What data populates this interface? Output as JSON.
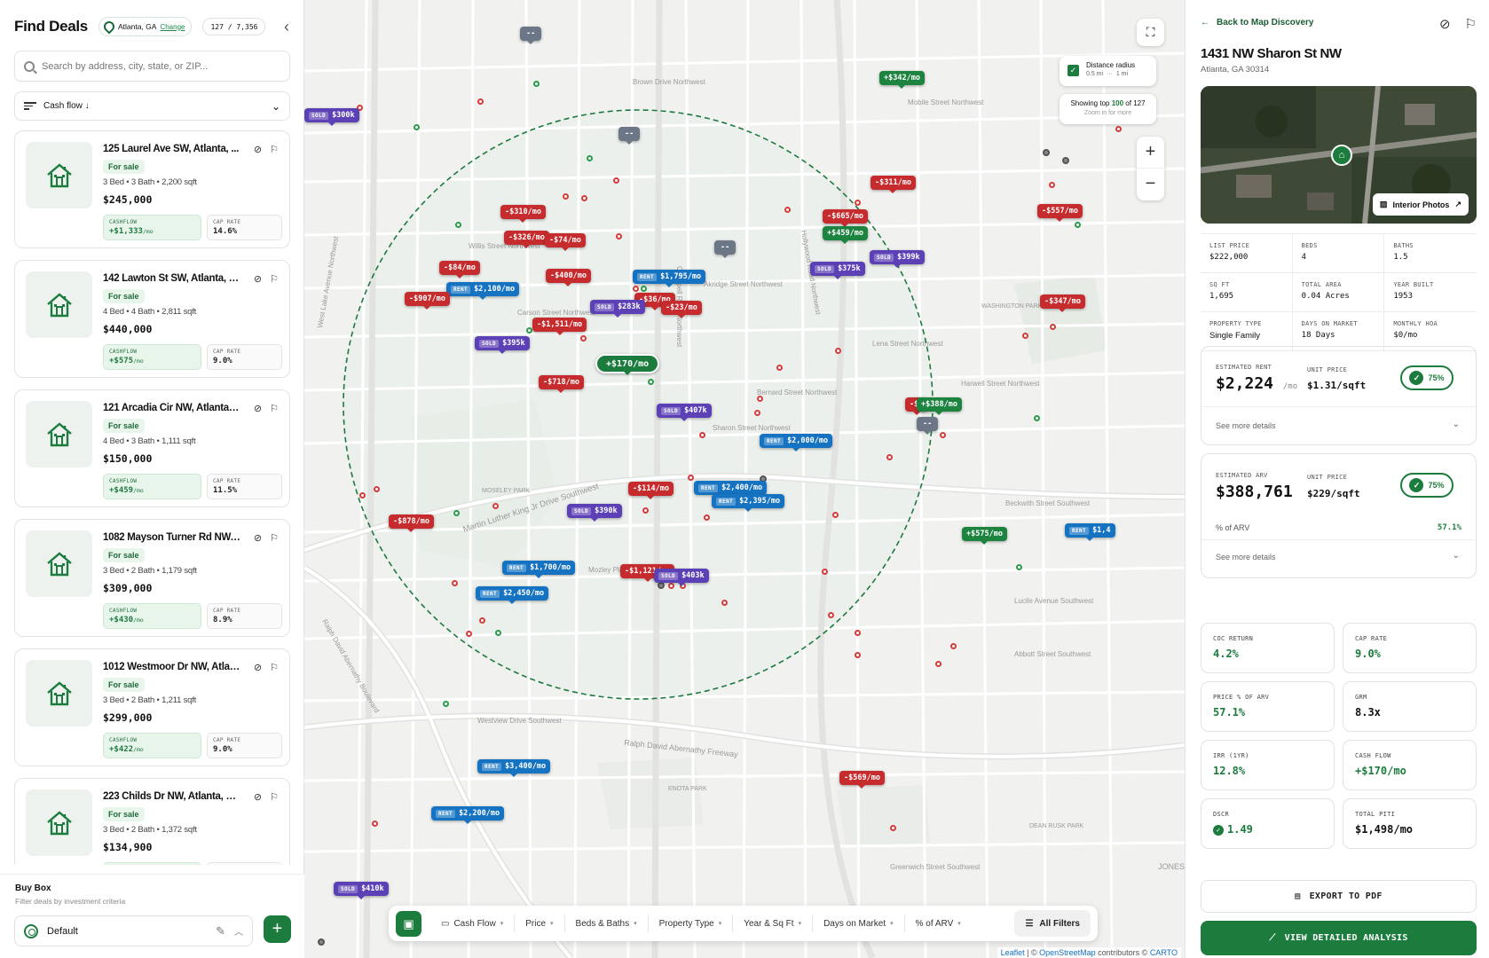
{
  "header": {
    "title": "Find Deals",
    "location": "Atlanta, GA",
    "change_label": "Change",
    "count": "127 / 7,356"
  },
  "search": {
    "placeholder": "Search by address, city, state, or ZIP..."
  },
  "sort": {
    "label": "Cash flow ↓"
  },
  "listings": [
    {
      "address": "125 Laurel Ave SW, Atlanta, ...",
      "status": "For sale",
      "specs": "3 Bed • 3 Bath • 2,200 sqft",
      "price": "$245,000",
      "cashflow_label": "CASHFLOW",
      "cashflow": "+$1,333",
      "cashflow_unit": "/mo",
      "cap_label": "CAP RATE",
      "cap_rate": "14.6%"
    },
    {
      "address": "142 Lawton St SW, Atlanta, G...",
      "status": "For sale",
      "specs": "4 Bed • 4 Bath • 2,811 sqft",
      "price": "$440,000",
      "cashflow_label": "CASHFLOW",
      "cashflow": "+$575",
      "cashflow_unit": "/mo",
      "cap_label": "CAP RATE",
      "cap_rate": "9.0%"
    },
    {
      "address": "121 Arcadia Cir NW, Atlanta, ...",
      "status": "For sale",
      "specs": "4 Bed • 3 Bath • 1,111 sqft",
      "price": "$150,000",
      "cashflow_label": "CASHFLOW",
      "cashflow": "+$459",
      "cashflow_unit": "/mo",
      "cap_label": "CAP RATE",
      "cap_rate": "11.5%"
    },
    {
      "address": "1082 Mayson Turner Rd NW, ...",
      "status": "For sale",
      "specs": "3 Bed • 2 Bath • 1,179 sqft",
      "price": "$309,000",
      "cashflow_label": "CASHFLOW",
      "cashflow": "+$430",
      "cashflow_unit": "/mo",
      "cap_label": "CAP RATE",
      "cap_rate": "8.9%"
    },
    {
      "address": "1012 Westmoor Dr NW, Atlan...",
      "status": "For sale",
      "specs": "3 Bed • 2 Bath • 1,211 sqft",
      "price": "$299,000",
      "cashflow_label": "CASHFLOW",
      "cashflow": "+$422",
      "cashflow_unit": "/mo",
      "cap_label": "CAP RATE",
      "cap_rate": "9.0%"
    },
    {
      "address": "223 Childs Dr NW, Atlanta, G...",
      "status": "For sale",
      "specs": "3 Bed • 2 Bath • 1,372 sqft",
      "price": "$134,900",
      "cashflow_label": "CASHFLOW",
      "cashflow": "",
      "cashflow_unit": "",
      "cap_label": "CAP RATE",
      "cap_rate": ""
    }
  ],
  "buybox": {
    "title": "Buy Box",
    "subtitle": "Filter deals by investment criteria",
    "selected": "Default"
  },
  "map": {
    "distance_label": "Distance radius",
    "radius_options": [
      "0.5 mi",
      "1 mi"
    ],
    "showing_prefix": "Showing top",
    "showing_count": "100",
    "showing_of": "of",
    "showing_total": "127",
    "zoom_hint": "Zoom in for more",
    "zoom_in": "+",
    "zoom_out": "−",
    "attribution_leaflet": "Leaflet",
    "attribution_osm": "OpenStreetMap",
    "attribution_mid": " contributors © ",
    "attribution_carto": "CARTO",
    "street_labels": [
      "Brown Drive Northwest",
      "Mobile Street Northwest",
      "Chappell Road Northwest",
      "Willis Street Northwest",
      "Akridge Street Northwest",
      "Carson Street Northwest",
      "Bernard Street Northwest",
      "Sharon Street Northwest",
      "Hollywood Road Northwest",
      "Martin Luther King Jr Drive Southwest",
      "Mozley Place Southwest",
      "Westview Drive Southwest",
      "Ralph David Abernathy Freeway",
      "Ralph David Abernathy Boulevard",
      "West Lake Avenue Northwest",
      "Lena Street Northwest",
      "Harwell Street Northwest",
      "Beckwith Street Southwest",
      "Greenwich Street Southwest",
      "Lucile Avenue Southwest",
      "Abbott Street Southwest",
      "MOSELEY PARK",
      "WASHINGTON PARK",
      "ENOTA PARK",
      "DEAN RUSK PARK",
      "JONES HA"
    ],
    "markers": [
      {
        "kind": "dash",
        "label": "--"
      },
      {
        "kind": "pos",
        "label": "+$342/mo"
      },
      {
        "kind": "sold",
        "tag": "SOLD",
        "label": "$300k"
      },
      {
        "kind": "dash",
        "label": "--"
      },
      {
        "kind": "neg",
        "label": "-$311/mo"
      },
      {
        "kind": "neg",
        "label": "-$310/mo"
      },
      {
        "kind": "neg",
        "label": "-$665/mo"
      },
      {
        "kind": "neg",
        "label": "-$557/mo"
      },
      {
        "kind": "pos",
        "label": "+$459/mo"
      },
      {
        "kind": "neg",
        "label": "-$326/mo"
      },
      {
        "kind": "neg",
        "label": "-$74/mo"
      },
      {
        "kind": "dash",
        "label": "--"
      },
      {
        "kind": "sold",
        "tag": "SOLD",
        "label": "$399k"
      },
      {
        "kind": "sold",
        "tag": "SOLD",
        "label": "$375k"
      },
      {
        "kind": "neg",
        "label": "-$84/mo"
      },
      {
        "kind": "neg",
        "label": "-$400/mo"
      },
      {
        "kind": "rent",
        "tag": "RENT",
        "label": "$1,795/mo"
      },
      {
        "kind": "rent",
        "tag": "RENT",
        "label": "$2,100/mo"
      },
      {
        "kind": "neg",
        "label": "-$907/mo"
      },
      {
        "kind": "neg",
        "label": "-$36/mo"
      },
      {
        "kind": "sold",
        "tag": "SOLD",
        "label": "$283k"
      },
      {
        "kind": "neg",
        "label": "-$23/mo"
      },
      {
        "kind": "neg",
        "label": "-$347/mo"
      },
      {
        "kind": "neg",
        "label": "-$1,511/mo"
      },
      {
        "kind": "sold",
        "tag": "SOLD",
        "label": "$395k"
      },
      {
        "kind": "sel",
        "label": "+$170/mo"
      },
      {
        "kind": "neg",
        "label": "-$718/mo"
      },
      {
        "kind": "neg",
        "label": "-$1"
      },
      {
        "kind": "pos",
        "label": "+$388/mo"
      },
      {
        "kind": "sold",
        "tag": "SOLD",
        "label": "$407k"
      },
      {
        "kind": "dash",
        "label": "--"
      },
      {
        "kind": "rent",
        "tag": "RENT",
        "label": "$2,000/mo"
      },
      {
        "kind": "neg",
        "label": "-$114/mo"
      },
      {
        "kind": "rent",
        "tag": "RENT",
        "label": "$2,400/mo"
      },
      {
        "kind": "rent",
        "tag": "RENT",
        "label": "$2,395/mo"
      },
      {
        "kind": "sold",
        "tag": "SOLD",
        "label": "$390k"
      },
      {
        "kind": "neg",
        "label": "-$878/mo"
      },
      {
        "kind": "pos",
        "label": "+$575/mo"
      },
      {
        "kind": "rent",
        "tag": "RENT",
        "label": "$1,4"
      },
      {
        "kind": "rent",
        "tag": "RENT",
        "label": "$1,700/mo"
      },
      {
        "kind": "neg",
        "label": "-$1,121/mo"
      },
      {
        "kind": "sold",
        "tag": "SOLD",
        "label": "$403k"
      },
      {
        "kind": "rent",
        "tag": "RENT",
        "label": "$2,450/mo"
      },
      {
        "kind": "rent",
        "tag": "RENT",
        "label": "$3,400/mo"
      },
      {
        "kind": "neg",
        "label": "-$569/mo"
      },
      {
        "kind": "rent",
        "tag": "RENT",
        "label": "$2,200/mo"
      },
      {
        "kind": "sold",
        "tag": "SOLD",
        "label": "$410k"
      }
    ]
  },
  "filterbar": {
    "items": [
      "Cash Flow",
      "Price",
      "Beds & Baths",
      "Property Type",
      "Year & Sq Ft",
      "Days on Market",
      "% of ARV"
    ],
    "all_filters": "All Filters"
  },
  "detail": {
    "back_label": "Back to Map Discovery",
    "address": "1431 NW Sharon St NW",
    "city": "Atlanta, GA 30314",
    "photos_button": "Interior Photos",
    "facts": [
      {
        "label": "LIST PRICE",
        "value": "$222,000"
      },
      {
        "label": "BEDS",
        "value": "4"
      },
      {
        "label": "BATHS",
        "value": "1.5"
      },
      {
        "label": "SQ FT",
        "value": "1,695"
      },
      {
        "label": "TOTAL AREA",
        "value": "0.04 Acres"
      },
      {
        "label": "YEAR BUILT",
        "value": "1953"
      },
      {
        "label": "PROPERTY TYPE",
        "value": "Single Family"
      },
      {
        "label": "DAYS ON MARKET",
        "value": "18 Days"
      },
      {
        "label": "MONTHLY HOA",
        "value": "$0/mo"
      }
    ],
    "rent": {
      "label": "ESTIMATED RENT",
      "value": "$2,224",
      "unit": "/mo",
      "unit_price_label": "UNIT PRICE",
      "unit_price": "$1.31/sqft",
      "confidence": "75%",
      "more": "See more details"
    },
    "arv": {
      "label": "ESTIMATED ARV",
      "value": "$388,761",
      "unit_price_label": "UNIT PRICE",
      "unit_price": "$229/sqft",
      "confidence": "75%",
      "pct_label": "% of ARV",
      "pct_value": "57.1%",
      "more": "See more details"
    },
    "metrics": [
      {
        "label": "COC RETURN",
        "value": "4.2%",
        "green": true
      },
      {
        "label": "CAP RATE",
        "value": "9.0%",
        "green": true
      },
      {
        "label": "PRICE % OF ARV",
        "value": "57.1%",
        "green": true
      },
      {
        "label": "GRM",
        "value": "8.3x",
        "green": false
      },
      {
        "label": "IRR (1YR)",
        "value": "12.8%",
        "green": true
      },
      {
        "label": "CASH FLOW",
        "value": "+$170/mo",
        "green": true
      },
      {
        "label": "DSCR",
        "value": "1.49",
        "green": true,
        "check": true
      },
      {
        "label": "TOTAL PITI",
        "value": "$1,498/mo",
        "green": false
      }
    ],
    "export_label": "EXPORT TO PDF",
    "analysis_label": "VIEW DETAILED ANALYSIS"
  },
  "colors": {
    "brand": "#1c7c3e",
    "negative": "#c62b2e",
    "rent": "#1673c2",
    "sold": "#5b41b5"
  }
}
